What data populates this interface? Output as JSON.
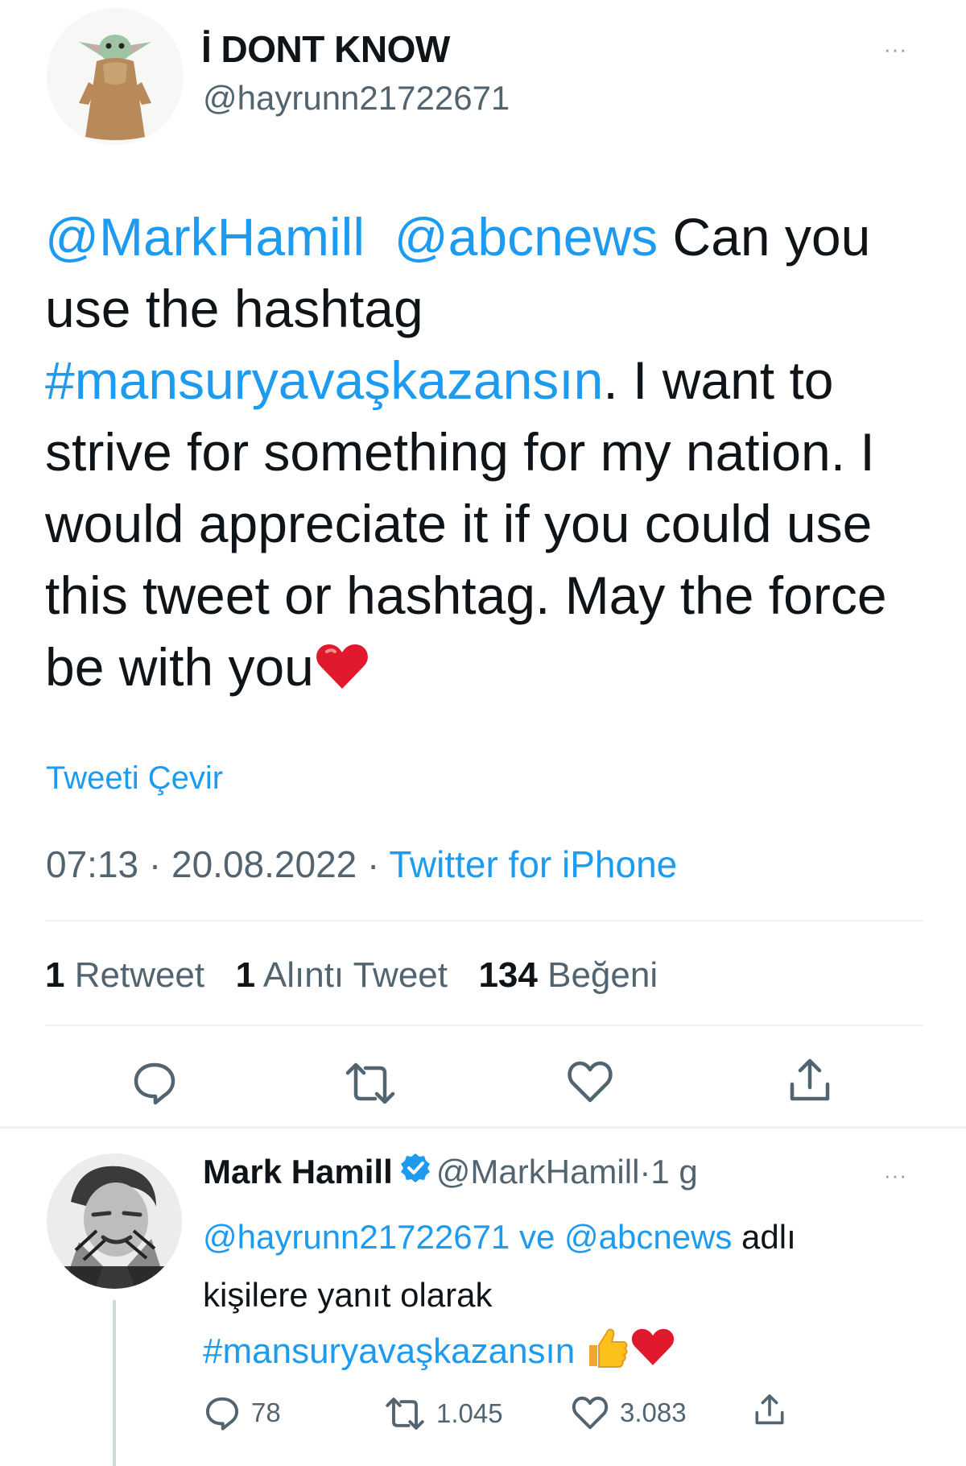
{
  "main_tweet": {
    "display_name": "İ DONT KNOW",
    "handle": "@hayrunn21722671",
    "more_label": "···",
    "mention_1": "@MarkHamill",
    "mention_2": "@abcnews",
    "text_1": " Can you use the hashtag ",
    "hashtag": "#mansuryavaşkazansın",
    "text_2": ". I want to strive for something for my nation. I would appreciate it if you could use this tweet or hashtag. May the force be with you",
    "translate_label": "Tweeti Çevir",
    "time": "07:13",
    "date": "20.08.2022",
    "separator": " · ",
    "source": "Twitter for iPhone",
    "stats": {
      "retweets_count": "1",
      "retweets_label": "Retweet",
      "quotes_count": "1",
      "quotes_label": "Alıntı Tweet",
      "likes_count": "134",
      "likes_label": "Beğeni"
    },
    "action_icons": [
      "reply-icon",
      "retweet-icon",
      "like-icon",
      "share-icon"
    ]
  },
  "reply": {
    "display_name": "Mark Hamill",
    "handle": "@MarkHamill",
    "separator": " · ",
    "time": "1 g",
    "more_label": "···",
    "reply_to_1": "@hayrunn21722671",
    "reply_conj": " ve ",
    "reply_to_2": "@abcnews",
    "reply_suffix": " adlı kişilere yanıt olarak",
    "hashtag": "#mansuryavaşkazansın",
    "replies_count": "78",
    "retweets_count": "1.045",
    "likes_count": "3.083"
  },
  "colors": {
    "link": "#1d9bf0",
    "text": "#0f1419",
    "muted": "#536471",
    "divider": "#eff3f4",
    "heart": "#e0192d"
  }
}
